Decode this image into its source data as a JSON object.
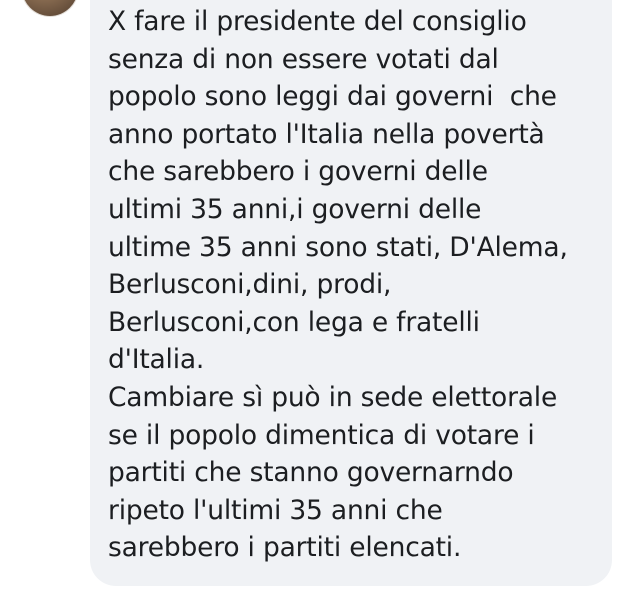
{
  "comment": {
    "text": "X fare il presidente del consiglio\nsenza di non essere votati dal\npopolo sono leggi dai governi  che\nanno portato l'Italia nella povertà\nche sarebbero i governi delle\nultimi 35 anni,i governi delle\nultime 35 anni sono stati, D'Alema,\nBerlusconi,dini, prodi,\nBerlusconi,con lega e fratelli\nd'Italia.\nCambiare sì può in sede elettorale\nse il popolo dimentica di votare i\npartiti che stanno governarndo\nripeto l'ultimi 35 anni che\nsarebbero i partiti elencati."
  }
}
